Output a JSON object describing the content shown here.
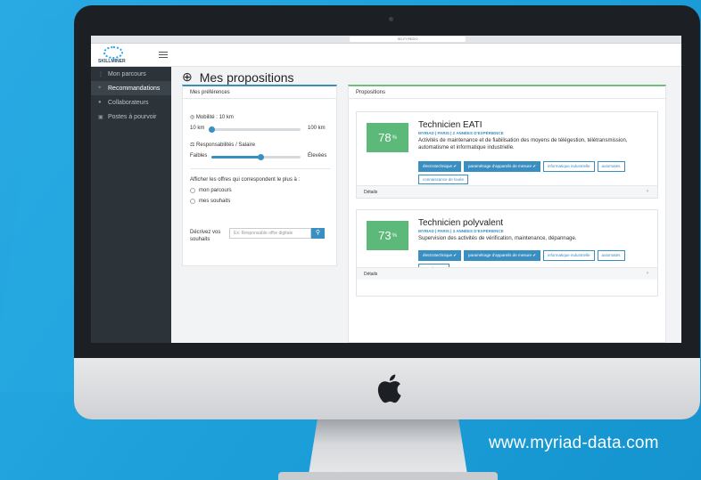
{
  "browser": {
    "url_text": "SD-FI REDO"
  },
  "app": {
    "logo_text": "SKILLMINER",
    "sidebar": [
      {
        "label": "Mon parcours",
        "icon": "route-icon"
      },
      {
        "label": "Recommandations",
        "icon": "target-icon"
      },
      {
        "label": "Collaborateurs",
        "icon": "people-icon"
      },
      {
        "label": "Postes à pourvoir",
        "icon": "briefcase-icon"
      }
    ],
    "page_title": "Mes propositions",
    "prefs": {
      "title": "Mes préférences",
      "mobility_label": "Mobilité : 10 km",
      "mobility_min": "10 km",
      "mobility_max": "100 km",
      "mobility_value": 0.0,
      "resp_label": "Responsabilités / Salaire",
      "resp_min": "Faibles",
      "resp_max": "Élevées",
      "resp_value": 0.55,
      "offers_question": "Afficher les offres qui correspondent le plus à :",
      "radio_1": "mon parcours",
      "radio_2": "mes souhaits",
      "describe_label": "Décrivez vos souhaits",
      "search_placeholder": "Ex: Responsable offre digitale"
    },
    "props": {
      "title": "Propositions",
      "cards": [
        {
          "score": "78",
          "title": "Technicien EATI",
          "meta": "MYRIAD | PARIS | 2 ANNÉES D'EXPÉRIENCE",
          "desc": "Activités de maintenance et de fiabilisation des moyens de télégestion, télétransmission, automatisme et informatique industrielle.",
          "tags": [
            {
              "label": "électrotechnique ✔",
              "on": true
            },
            {
              "label": "paramétrage d'appareils de mesure ✔",
              "on": true
            },
            {
              "label": "informatique industrielle",
              "on": false
            },
            {
              "label": "automates",
              "on": false
            },
            {
              "label": "connaissance de louée",
              "on": false
            }
          ],
          "footer": "Détails"
        },
        {
          "score": "73",
          "title": "Technicien polyvalent",
          "meta": "MYRIAD | PARIS | 3 ANNÉES D'EXPÉRIENCE",
          "desc": "Supervision des activités de vérification, maintenance, dépannage.",
          "tags": [
            {
              "label": "électrotechnique ✔",
              "on": true
            },
            {
              "label": "paramétrage d'appareils de mesure ✔",
              "on": true
            },
            {
              "label": "informatique industrielle",
              "on": false
            },
            {
              "label": "automates",
              "on": false
            },
            {
              "label": "coordination",
              "on": false
            }
          ],
          "footer": "Détails"
        }
      ]
    }
  },
  "footer_website": "www.myriad-data.com",
  "colors": {
    "background": "#1ea1db",
    "accent": "#3a8fc2",
    "score": "#5cb979",
    "sidebar": "#2d3439"
  }
}
